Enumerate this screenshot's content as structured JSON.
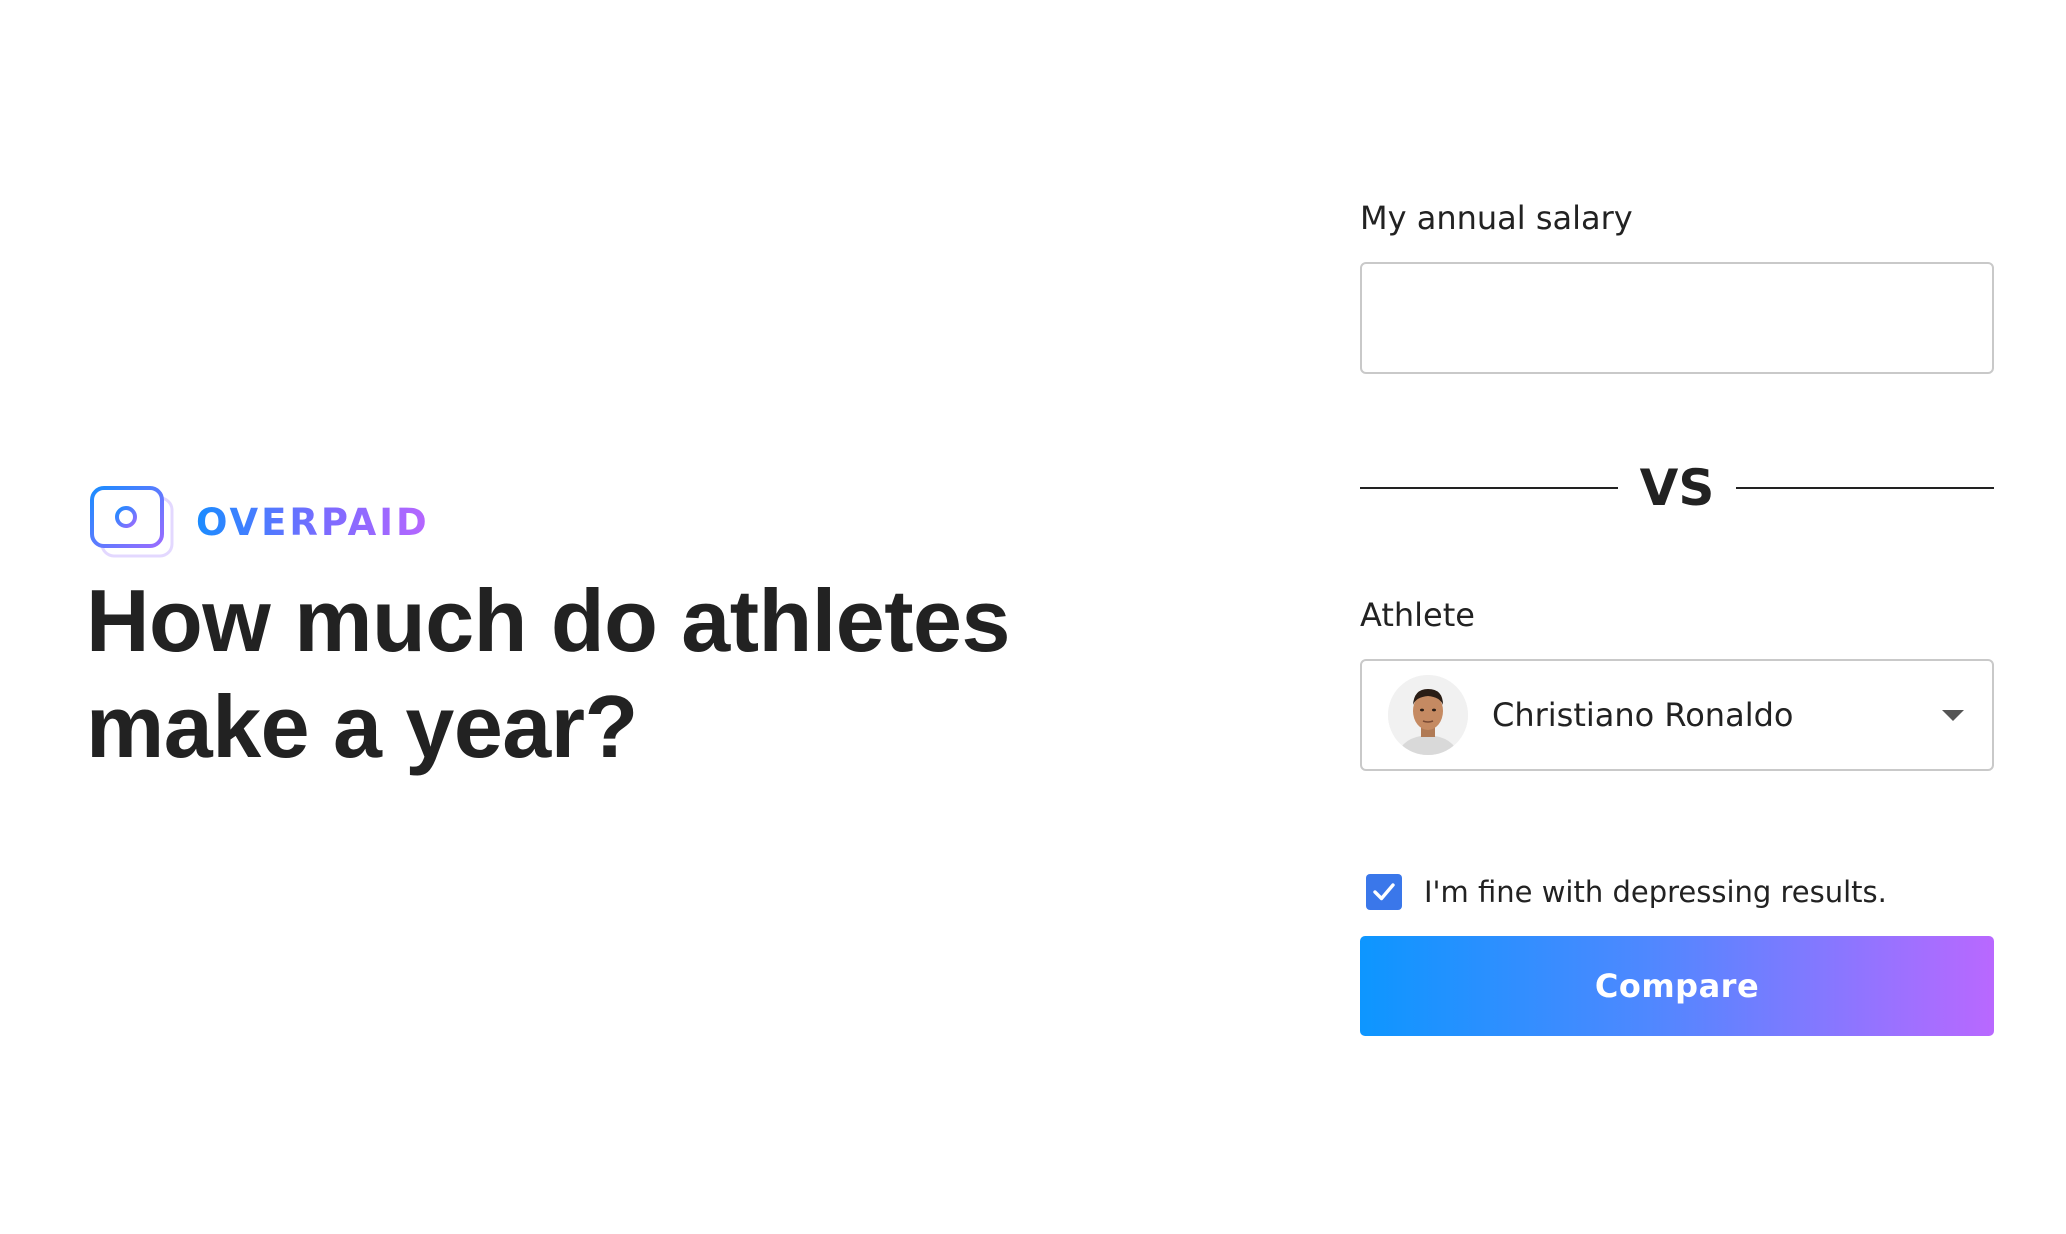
{
  "brand": {
    "name": "OVERPAID",
    "logo_icon": "overpaid-logo-icon"
  },
  "hero": {
    "title": "How much do athletes make a year?"
  },
  "form": {
    "salary": {
      "label": "My annual salary",
      "value": "",
      "placeholder": ""
    },
    "vs_label": "VS",
    "athlete": {
      "label": "Athlete",
      "selected": "Christiano Ronaldo",
      "avatar_icon": "athlete-avatar",
      "dropdown_icon": "caret-down-icon"
    },
    "agree": {
      "label": "I'm fine with depressing results.",
      "checked": true
    },
    "submit_label": "Compare"
  },
  "colors": {
    "accent_start": "#0d96ff",
    "accent_end": "#b968ff",
    "checkbox": "#3a77ea",
    "text": "#222222",
    "border": "#c9c9c9"
  }
}
